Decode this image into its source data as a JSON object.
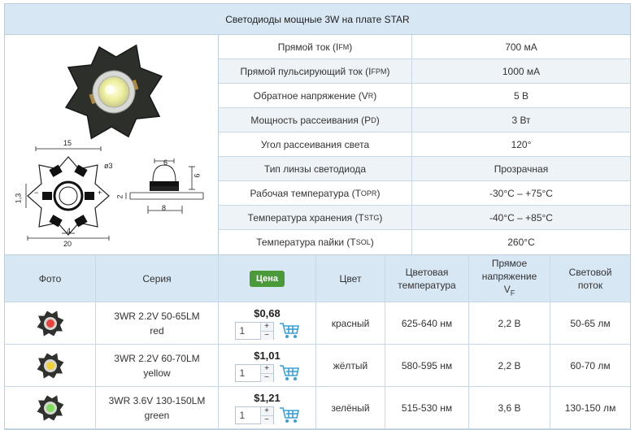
{
  "title": "Светодиоды мощные 3W на плате STAR",
  "specs": [
    {
      "name": "Прямой ток (I",
      "sub": "FM",
      "close": ")",
      "value": "700 мА"
    },
    {
      "name": "Прямой пульсирующий ток (I",
      "sub": "FPM",
      "close": ")",
      "value": "1000 мА"
    },
    {
      "name": "Обратное напряжение (V",
      "sub": "R",
      "close": ")",
      "value": "5 В"
    },
    {
      "name": "Мощность рассеивания (P",
      "sub": "D",
      "close": ")",
      "value": "3 Вт"
    },
    {
      "name": "Угол рассеивания света",
      "sub": "",
      "close": "",
      "value": "120°"
    },
    {
      "name": "Тип линзы светодиода",
      "sub": "",
      "close": "",
      "value": "Прозрачная"
    },
    {
      "name": "Рабочая температура (T",
      "sub": "OPR",
      "close": ")",
      "value": "-30°C – +75°C"
    },
    {
      "name": "Температура хранения (T",
      "sub": "STG",
      "close": ")",
      "value": "-40°C – +85°C"
    },
    {
      "name": "Температура пайки (T",
      "sub": "SOL",
      "close": ")",
      "value": "260°C"
    }
  ],
  "drawing": {
    "dim_15": "15",
    "dim_20": "20",
    "dim_4": "4",
    "dim_13": "1,3",
    "dim_phi3": "ø3",
    "dim_6a": "6",
    "dim_6b": "6",
    "dim_2": "2",
    "dim_8": "8"
  },
  "table": {
    "headers": {
      "photo": "Фото",
      "series": "Серия",
      "price": "Цена",
      "color": "Цвет",
      "temp_l1": "Цветовая",
      "temp_l2": "температура",
      "vf_l1": "Прямое",
      "vf_l2": "напряжение",
      "vf_l3": "V",
      "vf_sub": "F",
      "flux_l1": "Световой",
      "flux_l2": "поток"
    },
    "rows": [
      {
        "series_l1": "3WR 2.2V 50-65LM",
        "series_l2": "red",
        "price": "$0,68",
        "qty": "1",
        "color": "красный",
        "temp": "625-640 нм",
        "vf": "2,2 В",
        "flux": "50-65 лм",
        "led_color": "#e8453c"
      },
      {
        "series_l1": "3WR 2.2V 60-70LM",
        "series_l2": "yellow",
        "price": "$1,01",
        "qty": "1",
        "color": "жёлтый",
        "temp": "580-595 нм",
        "vf": "2,2 В",
        "flux": "60-70 лм",
        "led_color": "#f2d23a"
      },
      {
        "series_l1": "3WR 3.6V 130-150LM",
        "series_l2": "green",
        "price": "$1,21",
        "qty": "1",
        "color": "зелёный",
        "temp": "515-530 нм",
        "vf": "3,6 В",
        "flux": "130-150 лм",
        "led_color": "#7fdc5a"
      }
    ]
  },
  "colors": {
    "header_bg": "#d7e7f4",
    "border": "#b9cfe0",
    "price_badge": "#4a9a3a",
    "cart_icon": "#3aa0d8"
  }
}
